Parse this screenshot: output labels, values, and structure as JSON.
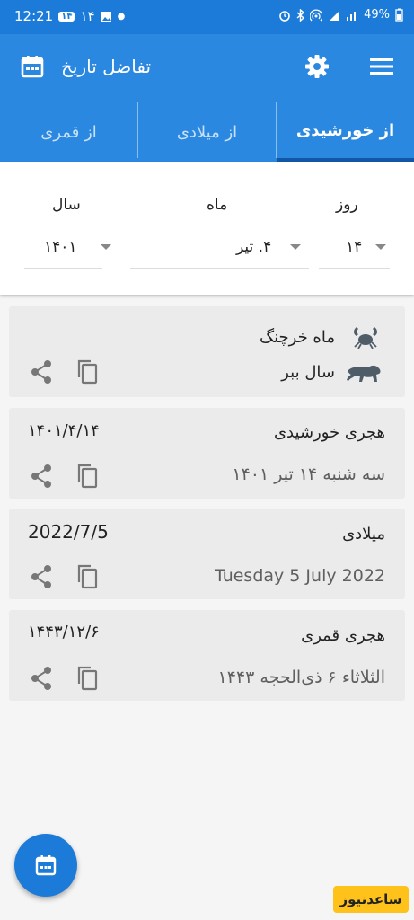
{
  "status_bar": {
    "time": "12:21",
    "badge": "۱۴",
    "badge_text": "۱۴",
    "battery": "49%"
  },
  "app_bar": {
    "title": "تفاضل تاریخ"
  },
  "tabs": [
    {
      "label": "از خورشیدی",
      "active": true
    },
    {
      "label": "از میلادی",
      "active": false
    },
    {
      "label": "از قمری",
      "active": false
    }
  ],
  "picker": {
    "day_label": "روز",
    "month_label": "ماه",
    "year_label": "سال",
    "day_value": "۱۴",
    "month_value": "۴. تیر",
    "year_value": "۱۴۰۱"
  },
  "zodiac_card": {
    "month_sign": "ماه خرچنگ",
    "year_animal": "سال ببر"
  },
  "cards": [
    {
      "title": "هجری خورشیدی",
      "short": "۱۴۰۱/۴/۱۴",
      "long": "سه شنبه ۱۴ تیر ۱۴۰۱"
    },
    {
      "title": "میلادی",
      "short": "2022/7/5",
      "long": "Tuesday 5 July 2022"
    },
    {
      "title": "هجری قمری",
      "short": "۱۴۴۳/۱۲/۶",
      "long": "الثلاثاء ۶ ذی‌الحجه ۱۴۴۳"
    }
  ],
  "watermark": "ساعدنیوز",
  "colors": {
    "primary": "#2b88e0",
    "status_bar": "#1c7bd8",
    "tab_indicator": "#1257a6",
    "card_bg": "#ebebeb",
    "watermark_bg": "#ffc21a"
  },
  "icons": [
    "menu-icon",
    "settings-icon",
    "calendar-icon",
    "share-icon",
    "copy-icon",
    "crab-icon",
    "tiger-icon"
  ]
}
